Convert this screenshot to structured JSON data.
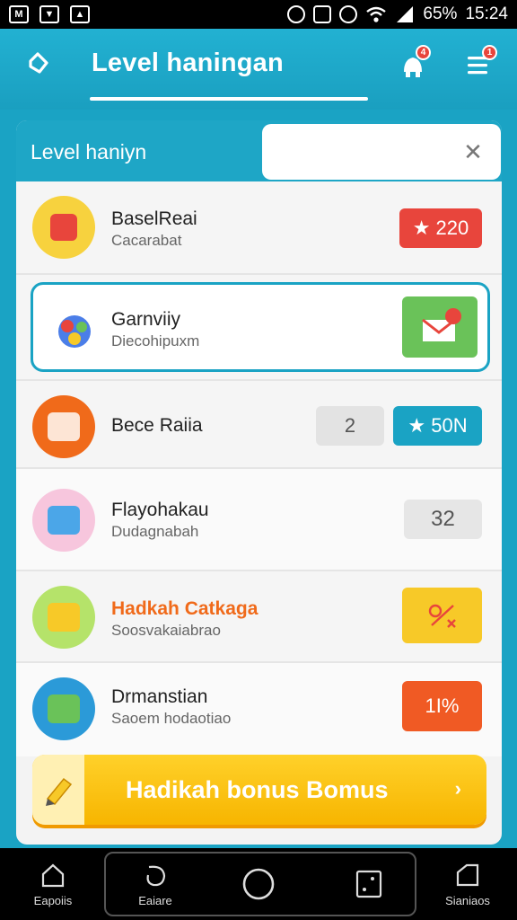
{
  "status_bar": {
    "battery": "65%",
    "time": "15:24",
    "left_icons": [
      "gmail-icon",
      "photo-icon",
      "image-icon"
    ],
    "right_icons": [
      "shield-icon",
      "sim-icon",
      "alarm-icon",
      "wifi-icon",
      "signal-icon"
    ]
  },
  "header": {
    "title": "Level haningan",
    "notification_count": "4",
    "menu_count": "1"
  },
  "panel": {
    "title": "Level haniyn",
    "search": {
      "value": "",
      "clear_icon": "close-icon"
    }
  },
  "items": [
    {
      "name": "BaselReai",
      "sub": "Cacarabat",
      "badge": "★ 220",
      "badge_color": "#e8453c",
      "avatar_color": "#f7d23e"
    },
    {
      "name": "Garnviiy",
      "sub": "Diecohipuxm",
      "badge": "",
      "badge_color": "#6ac259",
      "avatar_color": "#ffffff"
    },
    {
      "name": "Bece Raiia",
      "sub": "",
      "count": "2",
      "badge": "★ 50N",
      "badge_color": "#1aa3c4",
      "avatar_color": "#f06a1a"
    },
    {
      "name": "Flayohakau",
      "sub": "Dudagnabah",
      "count": "32",
      "avatar_color": "#f7c6dd"
    },
    {
      "name": "Hadkah Catkaga",
      "sub": "Soosvakaiabrao",
      "badge": "",
      "badge_color": "#f7c928",
      "avatar_color": "#b5e36a",
      "name_color": "#f06a1a"
    },
    {
      "name": "Drmanstian",
      "sub": "Saoem hodaotiao",
      "badge": "1I%",
      "badge_color": "#f05a24",
      "avatar_color": "#2b9ad8"
    }
  ],
  "bonus_button": {
    "label": "Hadikah bonus Bomus",
    "chevron": "›"
  },
  "bottom_nav": [
    {
      "label": "Eapoiis",
      "icon": "home-icon"
    },
    {
      "label": "Eaiare",
      "icon": "swirl-icon"
    },
    {
      "label": "",
      "icon": "circle-icon"
    },
    {
      "label": "",
      "icon": "card-icon"
    },
    {
      "label": "Sianiaos",
      "icon": "square-icon"
    }
  ]
}
